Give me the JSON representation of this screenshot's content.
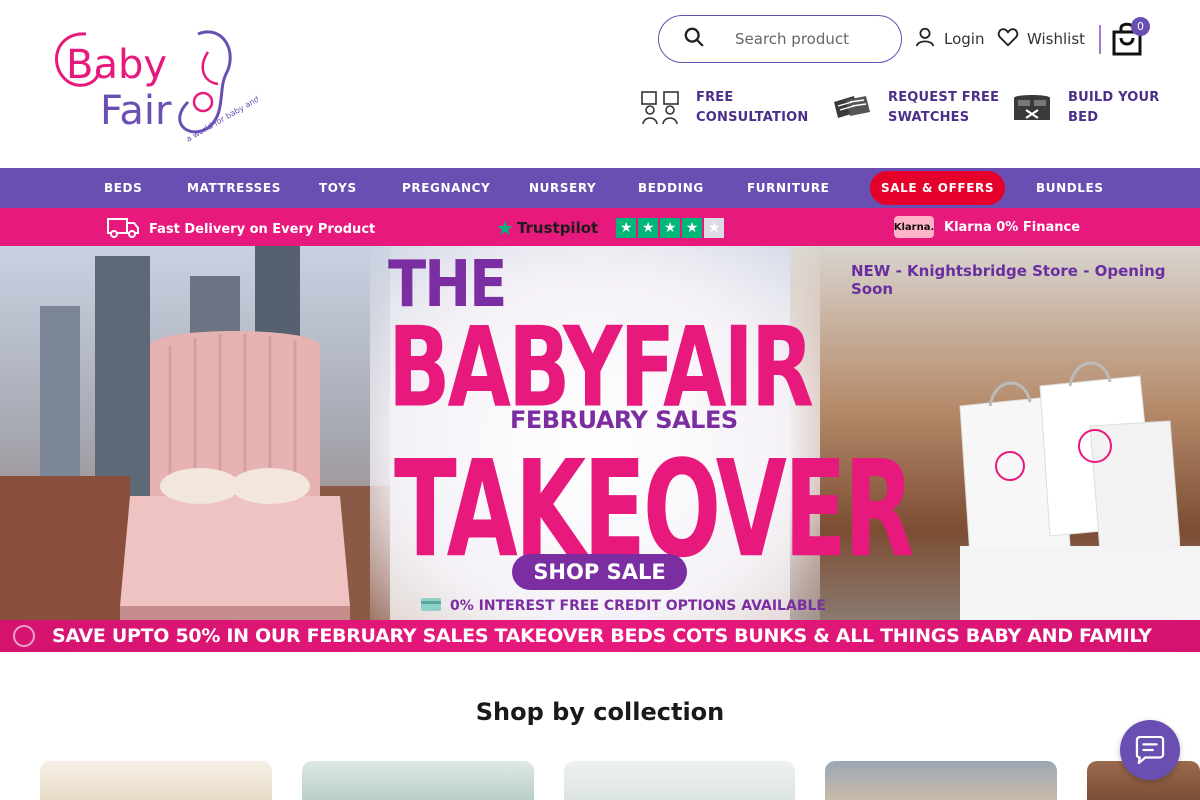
{
  "brand": {
    "logo_text_1": "Baby",
    "logo_text_2": "Fair",
    "tagline": "a world for baby and family",
    "primary": "#6a4fb3",
    "accent": "#e8197d"
  },
  "header": {
    "search_placeholder": "Search product",
    "login_label": "Login",
    "wishlist_label": "Wishlist",
    "cart_count": "0",
    "features": [
      {
        "line1": "FREE",
        "line2": "CONSULTATION",
        "icon": "consultation-icon"
      },
      {
        "line1": "REQUEST FREE",
        "line2": "SWATCHES",
        "icon": "swatches-icon"
      },
      {
        "line1": "BUILD YOUR",
        "line2": "BED",
        "icon": "bed-icon"
      }
    ]
  },
  "nav": {
    "items": [
      "BEDS",
      "MATTRESSES",
      "TOYS",
      "PREGNANCY",
      "NURSERY",
      "BEDDING",
      "FURNITURE",
      "SALE & OFFERS",
      "BUNDLES"
    ]
  },
  "promo": {
    "delivery": "Fast Delivery on Every Product",
    "trustpilot": "Trustpilot",
    "klarna_badge": "Klarna.",
    "klarna_text": "Klarna 0% Finance"
  },
  "hero": {
    "the": "THE",
    "babyfair": "BABYFAIR",
    "february": "FEBRUARY SALES",
    "takeover": "TAKEOVER",
    "shop_button": "SHOP SALE",
    "credit": "0% INTEREST FREE CREDIT OPTIONS AVAILABLE",
    "store_notice": "NEW - Knightsbridge Store - Opening Soon",
    "strip": "SAVE UPTO 50% IN OUR FEBRUARY SALES TAKEOVER BEDS COTS BUNKS & ALL THINGS BABY AND FAMILY"
  },
  "collection": {
    "title": "Shop by collection"
  }
}
